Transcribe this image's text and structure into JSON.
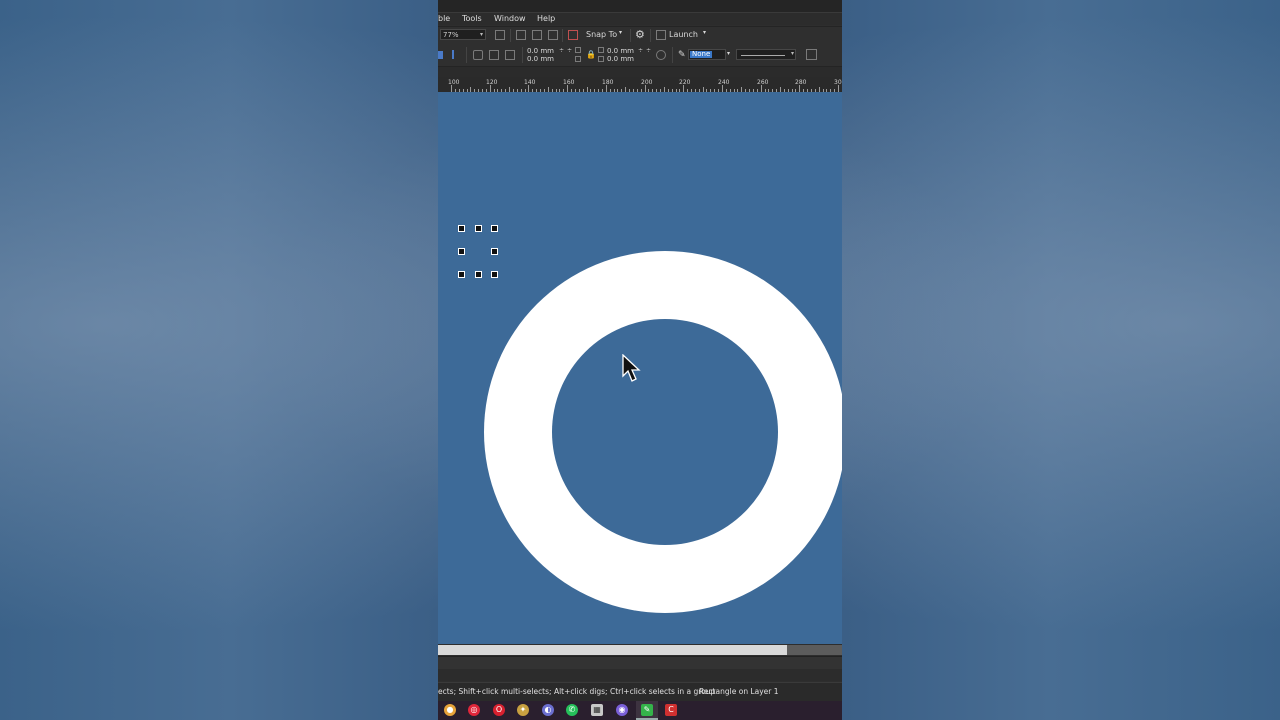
{
  "menubar": {
    "items": [
      {
        "label": "ble"
      },
      {
        "label": "Tools"
      },
      {
        "label": "Window"
      },
      {
        "label": "Help"
      }
    ]
  },
  "toolbar1": {
    "zoom_value": "77%",
    "snap_label": "Snap To",
    "launch_label": "Launch"
  },
  "toolbar2": {
    "pos_x": "0.0 mm",
    "pos_y": "0.0 mm",
    "size_w": "0.0 mm",
    "size_h": "0.0 mm",
    "stroke_value": "None"
  },
  "ruler": {
    "labels": [
      "100",
      "120",
      "140",
      "160",
      "180",
      "200",
      "220",
      "240",
      "260",
      "280",
      "30"
    ]
  },
  "canvas": {
    "background": "#3d6a98",
    "shape_fill": "#ffffff"
  },
  "statusbar": {
    "hint": "ects; Shift+click multi-selects; Alt+click digs; Ctrl+click selects in a group",
    "object_info": "Rectangle on Layer 1"
  },
  "taskbar": {
    "icons": [
      {
        "name": "chrome-icon",
        "color": "#e8a33a"
      },
      {
        "name": "target-app-icon",
        "color": "#e0263a"
      },
      {
        "name": "opera-icon",
        "color": "#d8202f"
      },
      {
        "name": "bird-app-icon",
        "color": "#c8a040"
      },
      {
        "name": "browser-icon",
        "color": "#6b6fd0"
      },
      {
        "name": "whatsapp-icon",
        "color": "#25c05a"
      },
      {
        "name": "calculator-icon",
        "color": "#c8c8c8"
      },
      {
        "name": "firefox-icon",
        "color": "#7a5fd8"
      },
      {
        "name": "coreldraw-icon",
        "color": "#34b34a"
      },
      {
        "name": "corel-app-icon",
        "color": "#d03030"
      }
    ]
  }
}
